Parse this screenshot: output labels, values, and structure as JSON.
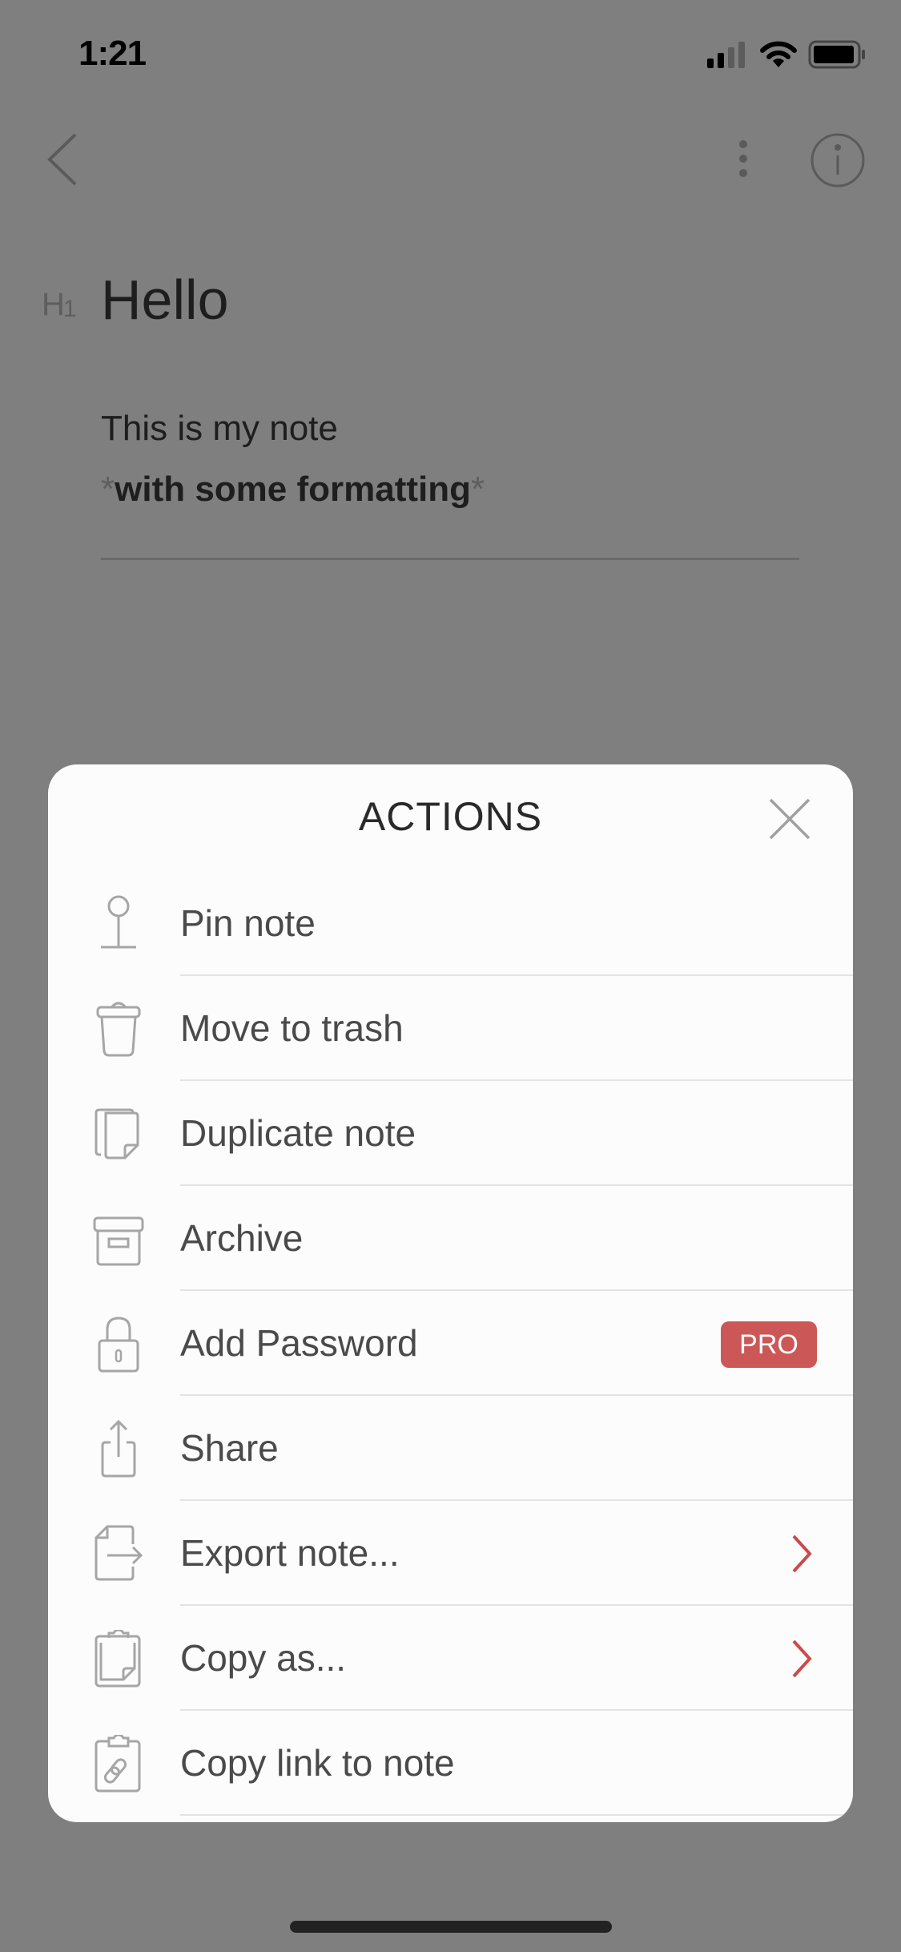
{
  "status_bar": {
    "time": "1:21",
    "icons": [
      "cellular-signal-icon",
      "wifi-icon",
      "battery-icon"
    ]
  },
  "nav": {
    "back_icon": "chevron-left-icon",
    "more_icon": "vertical-ellipsis-icon",
    "info_icon": "info-circle-icon"
  },
  "note": {
    "heading_marker": "H",
    "heading_level": "1",
    "title": "Hello",
    "line1": "This is my note",
    "line2_prefix": "*",
    "line2_bold": "with some formatting",
    "line2_suffix": "*"
  },
  "sheet": {
    "title": "ACTIONS",
    "close_icon": "close-icon",
    "items": [
      {
        "label": "Pin note",
        "icon": "pin-icon"
      },
      {
        "label": "Move to trash",
        "icon": "trash-icon"
      },
      {
        "label": "Duplicate note",
        "icon": "duplicate-icon"
      },
      {
        "label": "Archive",
        "icon": "archive-icon"
      },
      {
        "label": "Add Password",
        "icon": "lock-icon",
        "badge": "PRO"
      },
      {
        "label": "Share",
        "icon": "share-icon"
      },
      {
        "label": "Export note...",
        "icon": "export-icon",
        "has_submenu": true
      },
      {
        "label": "Copy as...",
        "icon": "clipboard-icon",
        "has_submenu": true
      },
      {
        "label": "Copy link to note",
        "icon": "clipboard-link-icon"
      }
    ]
  },
  "colors": {
    "overlay": "#7f7f7f",
    "sheet_bg": "#fcfcfc",
    "accent_red": "#cc5757",
    "icon_gray": "#a6a6a6",
    "label_gray": "#4a4a4a"
  }
}
